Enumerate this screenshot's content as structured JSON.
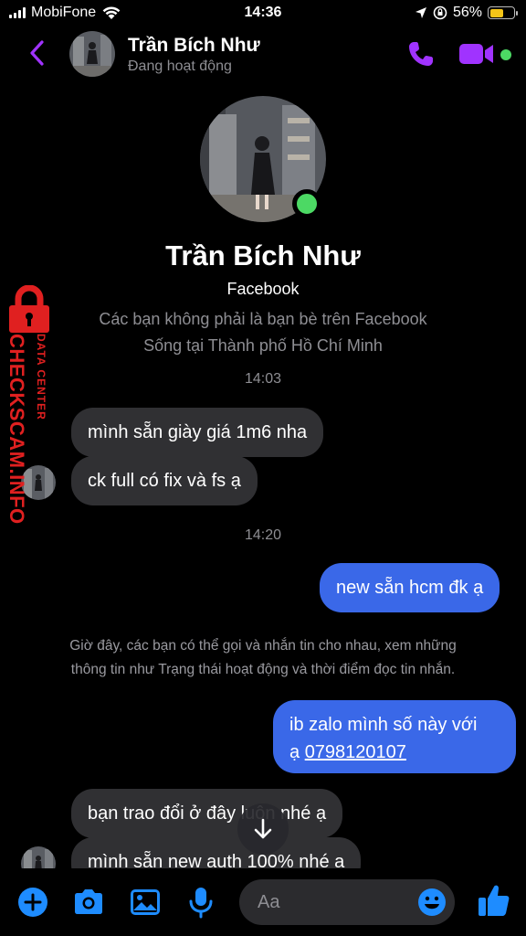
{
  "status_bar": {
    "carrier": "MobiFone",
    "time": "14:36",
    "battery_percent": "56%",
    "battery_level": 0.56,
    "icons": [
      "signal-icon",
      "wifi-icon",
      "location-icon",
      "orientation-lock-icon",
      "battery-icon"
    ]
  },
  "header": {
    "name": "Trần Bích Như",
    "status": "Đang hoạt động",
    "icons": [
      "back-icon",
      "phone-icon",
      "video-icon"
    ]
  },
  "profile": {
    "name": "Trần Bích Như",
    "source": "Facebook",
    "info_line1": "Các bạn không phải là bạn bè trên Facebook",
    "info_line2": "Sống tại Thành phố Hồ Chí Minh"
  },
  "watermark": {
    "brand": "CHECKSCAM.INFO",
    "tagline": "DATA CENTER",
    "color": "#e02020"
  },
  "conversation": {
    "time1": "14:03",
    "time2": "14:20",
    "messages": [
      {
        "direction": "in",
        "text": "mình sẵn giày giá 1m6 nha"
      },
      {
        "direction": "in",
        "text": "ck full có fix và fs ạ"
      },
      {
        "direction": "out",
        "text": "new sẵn hcm đk ạ"
      },
      {
        "direction": "out",
        "text_line1": "ib zalo mình số này với",
        "text_prefix": "ạ ",
        "link": "0798120107"
      },
      {
        "direction": "in",
        "text": "bạn trao đổi ở đây luôn nhé ạ"
      },
      {
        "direction": "in",
        "text": "mình sẵn new auth 100% nhé ạ"
      }
    ],
    "notice_line1": "Giờ đây, các bạn có thể gọi và nhắn tin cho nhau, xem những",
    "notice_line2": "thông tin như Trạng thái hoạt động và thời điểm đọc tin nhắn."
  },
  "composer": {
    "placeholder": "Aa",
    "icons": [
      "plus-icon",
      "camera-icon",
      "photo-icon",
      "microphone-icon",
      "emoji-icon",
      "like-icon"
    ]
  },
  "colors": {
    "accent": "#a033ff",
    "outgoing_bubble": "#3a68e8",
    "incoming_bubble": "#303033",
    "online": "#4cd964",
    "composer_icon": "#1e8cff"
  }
}
